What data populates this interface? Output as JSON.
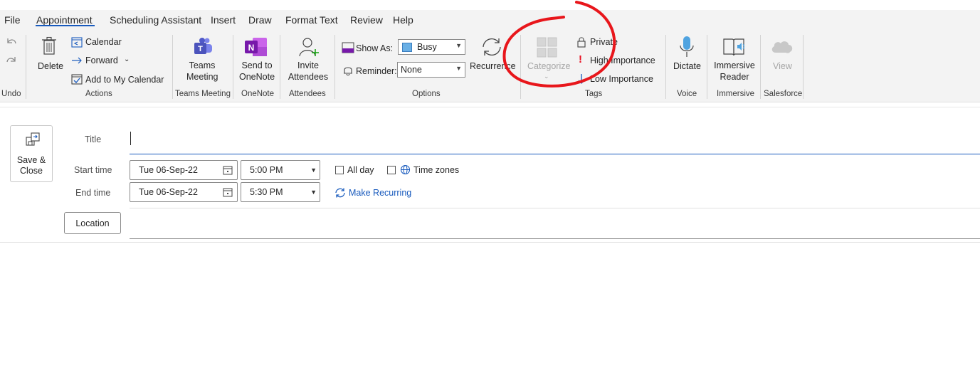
{
  "tabs": [
    {
      "label": "File"
    },
    {
      "label": "Appointment"
    },
    {
      "label": "Scheduling Assistant"
    },
    {
      "label": "Insert"
    },
    {
      "label": "Draw"
    },
    {
      "label": "Format Text"
    },
    {
      "label": "Review"
    },
    {
      "label": "Help"
    }
  ],
  "ribbon": {
    "undo_group": "Undo",
    "actions": {
      "delete": "Delete",
      "calendar": "Calendar",
      "forward": "Forward",
      "add_to_calendar": "Add to My Calendar",
      "group": "Actions"
    },
    "teams": {
      "label_line1": "Teams",
      "label_line2": "Meeting",
      "group": "Teams Meeting"
    },
    "onenote": {
      "label_line1": "Send to",
      "label_line2": "OneNote",
      "group": "OneNote"
    },
    "attendees": {
      "label_line1": "Invite",
      "label_line2": "Attendees",
      "group": "Attendees"
    },
    "options": {
      "show_as_label": "Show As:",
      "show_as_value": "Busy",
      "reminder_label": "Reminder:",
      "reminder_value": "None",
      "recurrence": "Recurrence",
      "group": "Options"
    },
    "tags": {
      "categorize": "Categorize",
      "private": "Private",
      "high_importance": "High Importance",
      "low_importance": "Low Importance",
      "group": "Tags"
    },
    "voice": {
      "dictate": "Dictate",
      "group": "Voice"
    },
    "immersive": {
      "label_line1": "Immersive",
      "label_line2": "Reader",
      "group": "Immersive"
    },
    "salesforce": {
      "view": "View",
      "group": "Salesforce"
    }
  },
  "form": {
    "save_close_line1": "Save &",
    "save_close_line2": "Close",
    "title_label": "Title",
    "title_value": "",
    "start_label": "Start time",
    "start_date": "Tue 06-Sep-22",
    "start_time": "5:00 PM",
    "end_label": "End time",
    "end_date": "Tue 06-Sep-22",
    "end_time": "5:30 PM",
    "all_day": "All day",
    "time_zones": "Time zones",
    "make_recurring": "Make Recurring",
    "location_button": "Location",
    "location_value": ""
  },
  "colors": {
    "accent": "#185abd",
    "annotation": "#e8161b",
    "busy_swatch": "#69afe5",
    "important": "#e81123"
  }
}
